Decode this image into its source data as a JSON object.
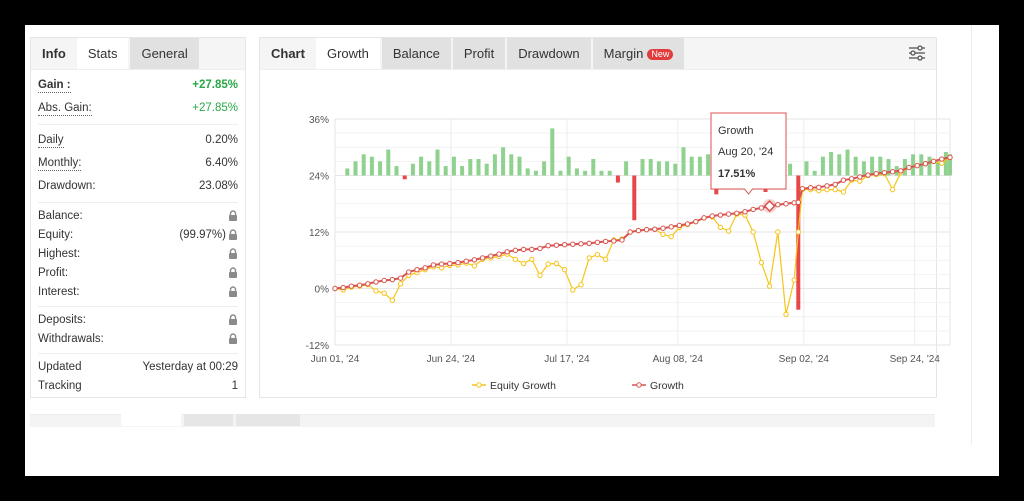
{
  "left_panel": {
    "tabs": [
      {
        "label": "Info",
        "state": "static"
      },
      {
        "label": "Stats",
        "state": "active"
      },
      {
        "label": "General",
        "state": "inactive"
      }
    ],
    "gain": {
      "label": "Gain :",
      "value": "+27.85%"
    },
    "abs_gain": {
      "label": "Abs. Gain:",
      "value": "+27.85%"
    },
    "daily": {
      "label": "Daily",
      "value": "0.20%"
    },
    "monthly": {
      "label": "Monthly:",
      "value": "6.40%"
    },
    "drawdown": {
      "label": "Drawdown:",
      "value": "23.08%"
    },
    "balance": {
      "label": "Balance:",
      "icon": "lock-icon"
    },
    "equity": {
      "label": "Equity:",
      "value": "(99.97%)",
      "icon": "lock-icon"
    },
    "highest": {
      "label": "Highest:",
      "icon": "lock-icon"
    },
    "profit": {
      "label": "Profit:",
      "icon": "lock-icon"
    },
    "interest": {
      "label": "Interest:",
      "icon": "lock-icon"
    },
    "deposits": {
      "label": "Deposits:",
      "icon": "lock-icon"
    },
    "withdrawals": {
      "label": "Withdrawals:",
      "icon": "lock-icon"
    },
    "updated": {
      "label": "Updated",
      "value": "Yesterday at 00:29"
    },
    "tracking": {
      "label": "Tracking",
      "value": "1"
    }
  },
  "chart_panel": {
    "tabs": [
      {
        "label": "Chart",
        "state": "static"
      },
      {
        "label": "Growth",
        "state": "active"
      },
      {
        "label": "Balance",
        "state": "inactive"
      },
      {
        "label": "Profit",
        "state": "inactive"
      },
      {
        "label": "Drawdown",
        "state": "inactive"
      },
      {
        "label": "Margin",
        "state": "inactive",
        "badge": "New"
      }
    ],
    "settings_icon": "sliders-icon"
  },
  "colors": {
    "growth": "#d9534f",
    "equity": "#f5c518",
    "bar_positive": "#8fd18f",
    "bar_negative": "#e8474a",
    "gain_green": "#27a845",
    "badge_red": "#e23b3b"
  },
  "chart_data": {
    "type": "line",
    "title": "",
    "xlabel": "",
    "ylabel": "",
    "ylim": [
      -12,
      36
    ],
    "y_ticks": [
      "-12%",
      "0%",
      "12%",
      "24%",
      "36%"
    ],
    "y_tick_values": [
      -12,
      0,
      12,
      24,
      36
    ],
    "x_tick_labels": [
      "Jun 01, '24",
      "Jun 24, '24",
      "Jul 17, '24",
      "Aug 08, '24",
      "Sep 02, '24",
      "Sep 24, '24"
    ],
    "x_tick_index": [
      0,
      23,
      46,
      68,
      93,
      115
    ],
    "grid": true,
    "legend": {
      "placement": "bottom",
      "entries": [
        "Equity Growth",
        "Growth"
      ]
    },
    "n_days": 122,
    "series": [
      {
        "name": "Growth",
        "points": [
          [
            0,
            0
          ],
          [
            2,
            0.2
          ],
          [
            4,
            0.5
          ],
          [
            6,
            0.7
          ],
          [
            8,
            1.0
          ],
          [
            10,
            1.4
          ],
          [
            12,
            1.7
          ],
          [
            14,
            1.9
          ],
          [
            16,
            2.2
          ],
          [
            18,
            3.5
          ],
          [
            20,
            4.0
          ],
          [
            22,
            4.4
          ],
          [
            24,
            5.0
          ],
          [
            26,
            5.2
          ],
          [
            28,
            5.3
          ],
          [
            30,
            5.5
          ],
          [
            32,
            5.8
          ],
          [
            34,
            6.1
          ],
          [
            36,
            6.5
          ],
          [
            38,
            6.9
          ],
          [
            40,
            7.3
          ],
          [
            42,
            7.8
          ],
          [
            44,
            8.1
          ],
          [
            46,
            8.3
          ],
          [
            48,
            8.3
          ],
          [
            50,
            8.5
          ],
          [
            52,
            9.1
          ],
          [
            54,
            9.2
          ],
          [
            56,
            9.3
          ],
          [
            58,
            9.4
          ],
          [
            60,
            9.5
          ],
          [
            62,
            9.6
          ],
          [
            64,
            9.8
          ],
          [
            66,
            10.0
          ],
          [
            68,
            10.1
          ],
          [
            70,
            10.3
          ],
          [
            72,
            12.0
          ],
          [
            74,
            12.3
          ],
          [
            76,
            12.5
          ],
          [
            78,
            12.6
          ],
          [
            80,
            12.8
          ],
          [
            82,
            13.1
          ],
          [
            84,
            13.4
          ],
          [
            86,
            13.7
          ],
          [
            88,
            14.2
          ],
          [
            90,
            15.0
          ],
          [
            92,
            15.4
          ],
          [
            94,
            15.6
          ],
          [
            96,
            15.8
          ],
          [
            98,
            16.0
          ],
          [
            100,
            16.3
          ],
          [
            102,
            16.8
          ],
          [
            104,
            17.1
          ],
          [
            106,
            17.51
          ],
          [
            108,
            17.8
          ],
          [
            110,
            18.0
          ],
          [
            112,
            18.2
          ],
          [
            113,
            18.3
          ],
          [
            114,
            21.2
          ],
          [
            116,
            21.4
          ],
          [
            118,
            21.5
          ],
          [
            120,
            21.8
          ],
          [
            122,
            22.1
          ],
          [
            124,
            23.0
          ],
          [
            126,
            23.3
          ],
          [
            128,
            23.7
          ],
          [
            130,
            24.1
          ],
          [
            132,
            24.4
          ],
          [
            134,
            24.6
          ],
          [
            136,
            24.8
          ],
          [
            138,
            25.0
          ],
          [
            140,
            25.7
          ],
          [
            142,
            26.1
          ],
          [
            144,
            26.5
          ],
          [
            146,
            27.0
          ],
          [
            148,
            27.5
          ],
          [
            150,
            27.85
          ]
        ]
      },
      {
        "name": "Equity Growth",
        "points": [
          [
            0,
            0
          ],
          [
            2,
            -0.3
          ],
          [
            4,
            0.3
          ],
          [
            6,
            0.5
          ],
          [
            8,
            0.8
          ],
          [
            10,
            -0.5
          ],
          [
            12,
            -1.0
          ],
          [
            14,
            -2.5
          ],
          [
            16,
            1.0
          ],
          [
            18,
            2.8
          ],
          [
            20,
            3.4
          ],
          [
            22,
            4.0
          ],
          [
            24,
            4.6
          ],
          [
            26,
            4.4
          ],
          [
            28,
            4.9
          ],
          [
            30,
            5.0
          ],
          [
            32,
            5.4
          ],
          [
            34,
            4.8
          ],
          [
            36,
            6.2
          ],
          [
            38,
            6.5
          ],
          [
            40,
            6.8
          ],
          [
            42,
            7.3
          ],
          [
            44,
            6.2
          ],
          [
            46,
            5.3
          ],
          [
            48,
            6.2
          ],
          [
            50,
            2.8
          ],
          [
            52,
            5.2
          ],
          [
            54,
            5.3
          ],
          [
            56,
            4.0
          ],
          [
            58,
            -0.3
          ],
          [
            60,
            0.8
          ],
          [
            62,
            6.5
          ],
          [
            64,
            7.2
          ],
          [
            66,
            6.2
          ],
          [
            68,
            10.3
          ],
          [
            70,
            10.5
          ],
          [
            72,
            12.0
          ],
          [
            74,
            12.3
          ],
          [
            76,
            12.5
          ],
          [
            78,
            12.6
          ],
          [
            80,
            11.5
          ],
          [
            82,
            11.0
          ],
          [
            84,
            13.0
          ],
          [
            86,
            13.6
          ],
          [
            88,
            14.2
          ],
          [
            90,
            15.0
          ],
          [
            92,
            15.2
          ],
          [
            94,
            13.0
          ],
          [
            96,
            12.2
          ],
          [
            98,
            15.8
          ],
          [
            100,
            15.6
          ],
          [
            102,
            12.0
          ],
          [
            104,
            5.5
          ],
          [
            106,
            0.5
          ],
          [
            108,
            12.0
          ],
          [
            110,
            -5.5
          ],
          [
            112,
            1.8
          ],
          [
            113,
            12.0
          ],
          [
            114,
            21.0
          ],
          [
            116,
            21.0
          ],
          [
            118,
            20.8
          ],
          [
            120,
            21.0
          ],
          [
            122,
            21.0
          ],
          [
            124,
            20.5
          ],
          [
            126,
            23.0
          ],
          [
            128,
            22.8
          ],
          [
            130,
            24.0
          ],
          [
            132,
            24.2
          ],
          [
            134,
            24.4
          ],
          [
            136,
            21.0
          ],
          [
            138,
            24.6
          ],
          [
            140,
            25.7
          ],
          [
            142,
            26.1
          ],
          [
            144,
            26.5
          ],
          [
            146,
            27.0
          ],
          [
            148,
            26.6
          ],
          [
            150,
            27.85
          ]
        ]
      },
      {
        "name": "Daily Change Bars",
        "note": "bars drawn around a baseline at 24% on the same axis, value = bar height in axis units (+ green, - red)",
        "points": [
          [
            3,
            1.5
          ],
          [
            5,
            3.0
          ],
          [
            7,
            4.5
          ],
          [
            9,
            4.0
          ],
          [
            11,
            3.0
          ],
          [
            13,
            5.5
          ],
          [
            15,
            2.0
          ],
          [
            17,
            -0.8
          ],
          [
            19,
            2.5
          ],
          [
            21,
            4.0
          ],
          [
            23,
            3.0
          ],
          [
            25,
            5.5
          ],
          [
            27,
            2.0
          ],
          [
            29,
            4.0
          ],
          [
            31,
            2.0
          ],
          [
            33,
            3.5
          ],
          [
            35,
            3.5
          ],
          [
            37,
            2.5
          ],
          [
            39,
            4.5
          ],
          [
            41,
            6.0
          ],
          [
            43,
            4.5
          ],
          [
            45,
            4.0
          ],
          [
            47,
            1.5
          ],
          [
            49,
            1.0
          ],
          [
            51,
            3.0
          ],
          [
            53,
            10.0
          ],
          [
            55,
            1.0
          ],
          [
            57,
            4.0
          ],
          [
            59,
            1.5
          ],
          [
            61,
            1.0
          ],
          [
            63,
            3.5
          ],
          [
            65,
            1.0
          ],
          [
            67,
            1.0
          ],
          [
            69,
            -1.5
          ],
          [
            71,
            3.0
          ],
          [
            73,
            -9.5
          ],
          [
            75,
            3.5
          ],
          [
            77,
            3.5
          ],
          [
            79,
            3.0
          ],
          [
            81,
            3.0
          ],
          [
            83,
            2.5
          ],
          [
            85,
            6.0
          ],
          [
            87,
            4.0
          ],
          [
            89,
            4.0
          ],
          [
            91,
            4.5
          ],
          [
            93,
            -4.0
          ],
          [
            95,
            4.0
          ],
          [
            97,
            3.0
          ],
          [
            99,
            2.0
          ],
          [
            101,
            2.5
          ],
          [
            103,
            3.0
          ],
          [
            105,
            -3.5
          ],
          [
            107,
            2.5
          ],
          [
            109,
            2.0
          ],
          [
            111,
            2.5
          ],
          [
            113,
            -28.5
          ],
          [
            115,
            3.0
          ],
          [
            117,
            1.0
          ],
          [
            119,
            4.0
          ],
          [
            121,
            5.0
          ],
          [
            123,
            4.5
          ],
          [
            125,
            5.5
          ],
          [
            127,
            4.0
          ],
          [
            129,
            3.0
          ],
          [
            131,
            4.0
          ],
          [
            133,
            4.0
          ],
          [
            135,
            3.5
          ],
          [
            137,
            2.0
          ],
          [
            139,
            3.5
          ],
          [
            141,
            4.5
          ],
          [
            143,
            4.5
          ],
          [
            145,
            4.0
          ],
          [
            147,
            3.0
          ],
          [
            149,
            5.0
          ],
          [
            150,
            4.5
          ]
        ]
      }
    ],
    "x_max_index": 150,
    "tooltip": {
      "series": "Growth",
      "date": "Aug 20, '24",
      "value": "17.51%",
      "x_index": 106
    }
  }
}
